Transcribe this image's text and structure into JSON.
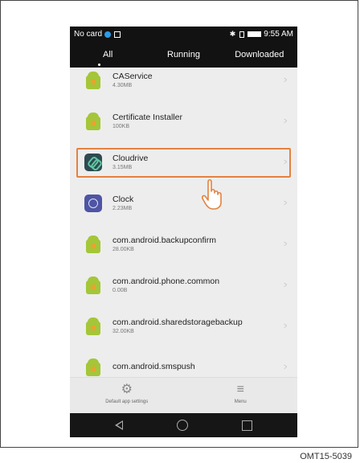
{
  "status": {
    "left": "No card",
    "time": "9:55 AM"
  },
  "tabs": [
    {
      "label": "All"
    },
    {
      "label": "Running"
    },
    {
      "label": "Downloaded"
    }
  ],
  "apps": [
    {
      "name": "CAService",
      "size": "4.30MB",
      "icon": "android-icon"
    },
    {
      "name": "Certificate Installer",
      "size": "100KB",
      "icon": "android-icon"
    },
    {
      "name": "Cloudrive",
      "size": "3.15MB",
      "icon": "cloudrive-icon"
    },
    {
      "name": "Clock",
      "size": "2.23MB",
      "icon": "clock-icon"
    },
    {
      "name": "com.android.backupconfirm",
      "size": "28.00KB",
      "icon": "android-icon"
    },
    {
      "name": "com.android.phone.common",
      "size": "0.00B",
      "icon": "android-icon"
    },
    {
      "name": "com.android.sharedstoragebackup",
      "size": "32.00KB",
      "icon": "android-icon"
    },
    {
      "name": "com.android.smspush",
      "size": "",
      "icon": "android-icon"
    }
  ],
  "bottom": {
    "settings_label": "Default app settings",
    "menu_label": "Menu"
  },
  "caption": "OMT15-5039",
  "colors": {
    "highlight": "#e3823f",
    "bars": "#121212"
  }
}
